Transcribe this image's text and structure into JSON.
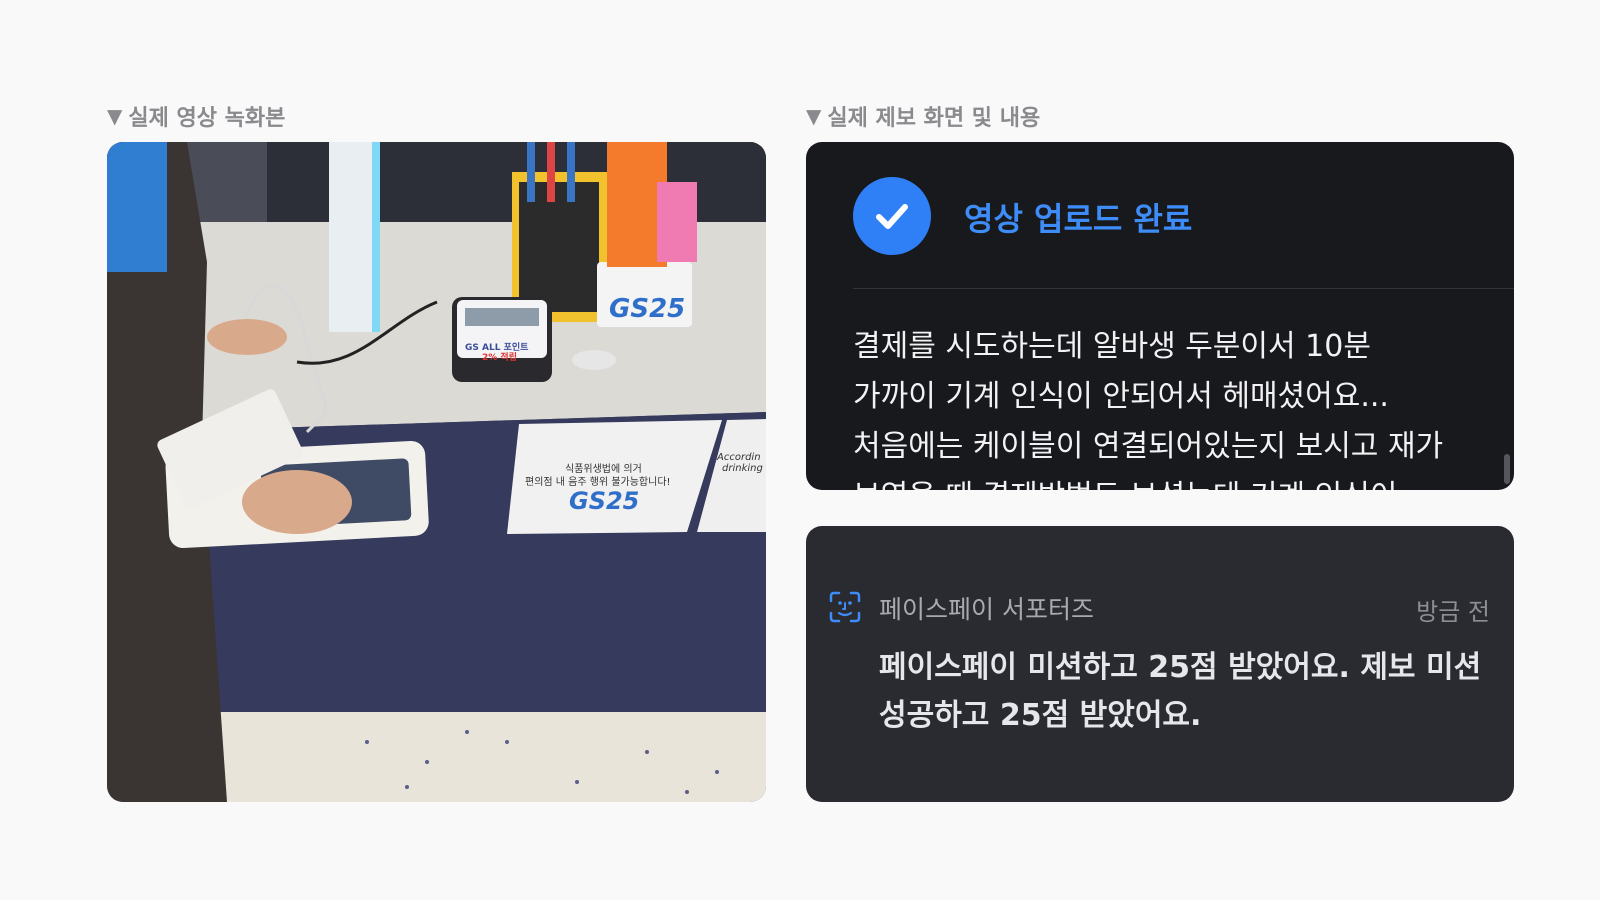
{
  "left_section": {
    "label": "실제 영상 녹화본",
    "marker": "▼"
  },
  "right_section": {
    "label": "실제 제보 화면 및 내용",
    "marker": "▼"
  },
  "photo": {
    "store_logo": "GS25",
    "sign_text_line1": "식품위생법에 의거",
    "sign_text_line2": "편의점 내 음주 행위 불가능합니다!",
    "sign_side_text1": "Accordin",
    "sign_side_text2": "drinking",
    "terminal_text_line1": "GS ALL 포인트",
    "terminal_text_line2": "2% 적립"
  },
  "upload_card": {
    "title": "영상 업로드 완료",
    "lines": [
      "결제를 시도하는데 알바생 두분이서 10분",
      "가까이 기계 인식이 안되어서 헤매셨어요...",
      "처음에는 케이블이 연결되어있는지 보시고 재가",
      "보였을 때 결제방법도 보셨는데 기계 인식이"
    ]
  },
  "comment_card": {
    "author": "페이스페이 서포터즈",
    "time": "방금 전",
    "text_line1": "페이스페이 미션하고 25점 받았어요. 제보 미션",
    "text_line2": "성공하고 25점 받았어요."
  },
  "colors": {
    "accent": "#2f80f6",
    "dark_card": "#18191c",
    "comment_card": "#2a2b30"
  }
}
